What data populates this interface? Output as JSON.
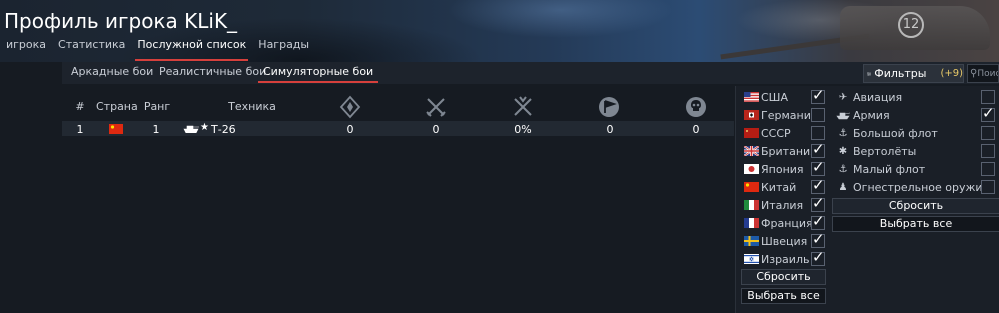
{
  "header": {
    "title": "Профиль игрока KLiK_",
    "banner_number": "12",
    "tabs": [
      {
        "label": "игрока"
      },
      {
        "label": "Статистика"
      },
      {
        "label": "Послужной список",
        "active": true
      },
      {
        "label": "Награды"
      }
    ]
  },
  "subtabs": [
    {
      "label": "Аркадные бои"
    },
    {
      "label": "Реалистичные бои"
    },
    {
      "label": "Симуляторные бои",
      "active": true
    }
  ],
  "filters": {
    "label": "Фильтры",
    "count": "(+9)",
    "icon": "sliders-icon"
  },
  "search": {
    "placeholder": "Поис",
    "icon": "search-icon"
  },
  "table": {
    "headers": {
      "num": "#",
      "country": "Страна",
      "rank": "Ранг",
      "vehicle": "Техника"
    },
    "stat_icons": [
      "battles-icon",
      "frags-icon",
      "winrate-icon",
      "flag-captures-icon",
      "deaths-icon"
    ],
    "rows": [
      {
        "num": "1",
        "country_flag": "china",
        "rank": "1",
        "vehicle": "Т-26",
        "s1": "0",
        "s2": "0",
        "s3": "0%",
        "s4": "0",
        "s5": "0"
      }
    ]
  },
  "countries": [
    {
      "name": "США",
      "flag": "usa",
      "checked": true
    },
    {
      "name": "Германия",
      "flag": "germany",
      "checked": false
    },
    {
      "name": "СССР",
      "flag": "ussr",
      "checked": false
    },
    {
      "name": "Британия",
      "flag": "britain",
      "checked": true
    },
    {
      "name": "Япония",
      "flag": "japan",
      "checked": true
    },
    {
      "name": "Китай",
      "flag": "china",
      "checked": true
    },
    {
      "name": "Италия",
      "flag": "italy",
      "checked": true
    },
    {
      "name": "Франция",
      "flag": "france",
      "checked": true
    },
    {
      "name": "Швеция",
      "flag": "sweden",
      "checked": true
    },
    {
      "name": "Израиль",
      "flag": "israel",
      "checked": true
    }
  ],
  "country_buttons": {
    "reset": "Сбросить",
    "select_all": "Выбрать все"
  },
  "types": [
    {
      "name": "Авиация",
      "icon": "plane-icon",
      "checked": false
    },
    {
      "name": "Армия",
      "icon": "tank-icon",
      "checked": true
    },
    {
      "name": "Большой флот",
      "icon": "big-ship-icon",
      "checked": false
    },
    {
      "name": "Вертолёты",
      "icon": "helicopter-icon",
      "checked": false
    },
    {
      "name": "Малый флот",
      "icon": "small-boat-icon",
      "checked": false
    },
    {
      "name": "Огнестрельное оружие",
      "icon": "soldier-icon",
      "checked": false
    }
  ],
  "type_buttons": {
    "reset": "Сбросить",
    "select_all": "Выбрать все"
  },
  "colors": {
    "accent": "#d6403c",
    "filter_count": "#e8c968"
  }
}
